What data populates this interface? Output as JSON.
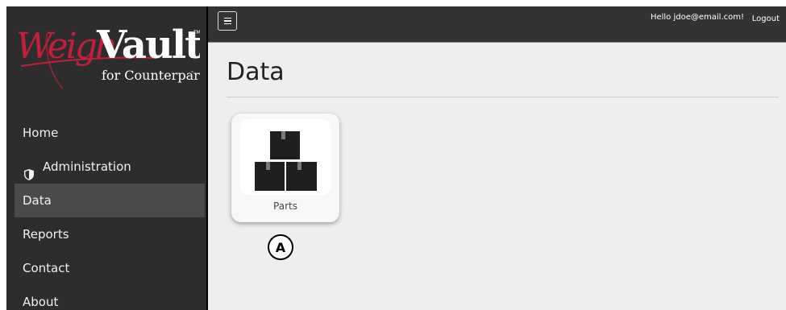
{
  "logo": {
    "brand": "WeighVault",
    "tagline": "for Counterpart"
  },
  "sidebar": {
    "items": [
      {
        "label": "Home",
        "icon": ""
      },
      {
        "label": "Administration",
        "icon": "shield-icon"
      },
      {
        "label": "Data",
        "icon": "",
        "active": true
      },
      {
        "label": "Reports",
        "icon": ""
      },
      {
        "label": "Contact",
        "icon": ""
      },
      {
        "label": "About",
        "icon": ""
      }
    ]
  },
  "topbar": {
    "menu_icon": "hamburger-icon",
    "greeting": "Hello jdoe@email.com!",
    "logout_label": "Logout"
  },
  "main": {
    "title": "Data",
    "tiles": [
      {
        "label": "Parts",
        "icon": "boxes-icon"
      }
    ]
  },
  "annotation": {
    "callout": "A"
  },
  "colors": {
    "sidebar_bg": "#2d2d2d",
    "sidebar_active": "#4a4a4a",
    "topbar_bg": "#333333",
    "content_bg": "#eeeeee",
    "brand_red": "#c41e3a"
  }
}
